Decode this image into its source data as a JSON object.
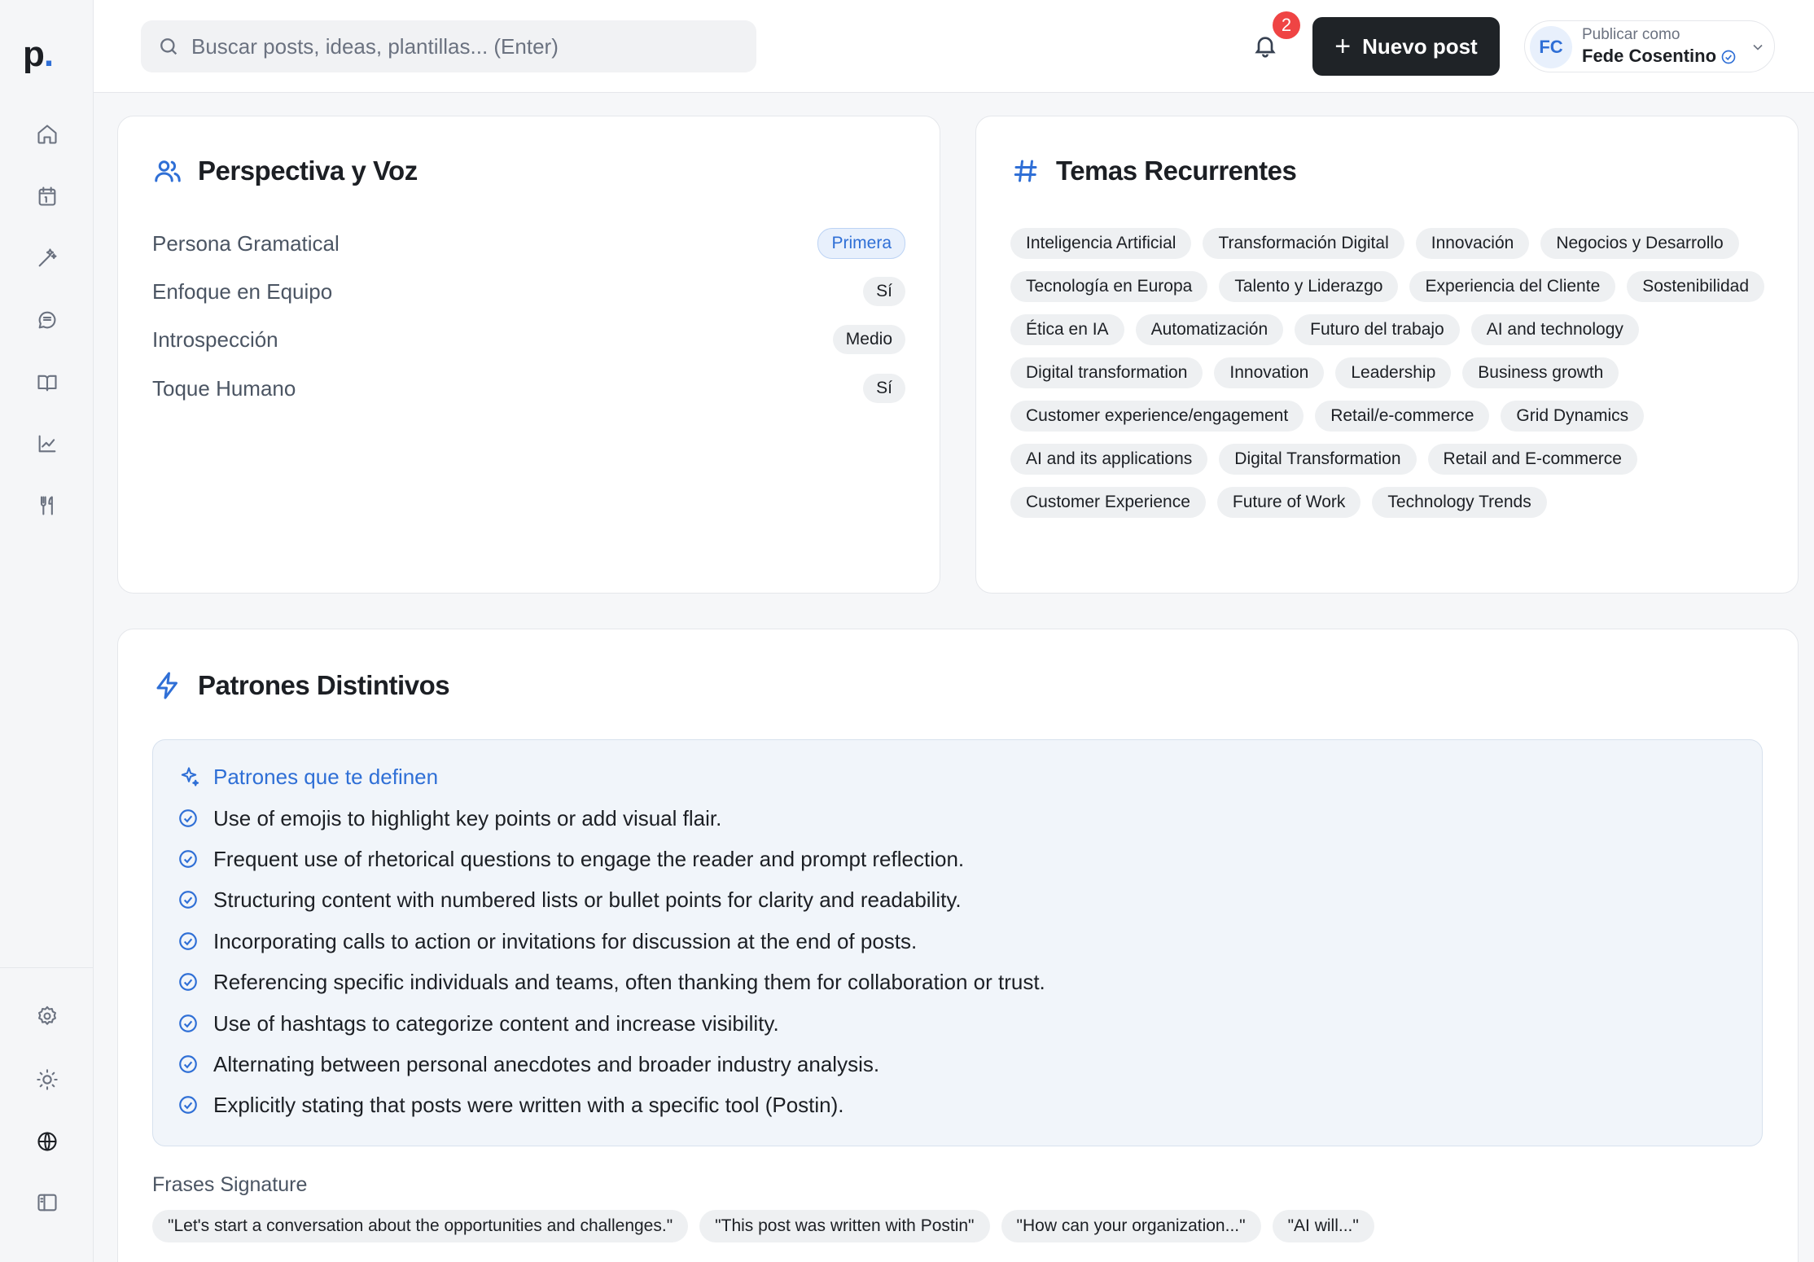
{
  "app": {
    "logo_text": "p",
    "logo_dot": "."
  },
  "search": {
    "placeholder": "Buscar posts, ideas, plantillas... (Enter)"
  },
  "notifications": {
    "count": "2"
  },
  "new_post": {
    "label": "Nuevo post"
  },
  "account": {
    "initials": "FC",
    "label": "Publicar como",
    "name": "Fede Cosentino"
  },
  "perspective": {
    "title": "Perspectiva y Voz",
    "rows": [
      {
        "label": "Persona Gramatical",
        "value": "Primera"
      },
      {
        "label": "Enfoque en Equipo",
        "value": "Sí"
      },
      {
        "label": "Introspección",
        "value": "Medio"
      },
      {
        "label": "Toque Humano",
        "value": "Sí"
      }
    ]
  },
  "topics": {
    "title": "Temas Recurrentes",
    "tags": [
      "Inteligencia Artificial",
      "Transformación Digital",
      "Innovación",
      "Negocios y Desarrollo",
      "Tecnología en Europa",
      "Talento y Liderazgo",
      "Experiencia del Cliente",
      "Sostenibilidad",
      "Ética en IA",
      "Automatización",
      "Futuro del trabajo",
      "AI and technology",
      "Digital transformation",
      "Innovation",
      "Leadership",
      "Business growth",
      "Customer experience/engagement",
      "Retail/e-commerce",
      "Grid Dynamics",
      "AI and its applications",
      "Digital Transformation",
      "Retail and E-commerce",
      "Customer Experience",
      "Future of Work",
      "Technology Trends"
    ]
  },
  "patterns": {
    "title": "Patrones Distintivos",
    "box_title": "Patrones que te definen",
    "items": [
      "Use of emojis to highlight key points or add visual flair.",
      "Frequent use of rhetorical questions to engage the reader and prompt reflection.",
      "Structuring content with numbered lists or bullet points for clarity and readability.",
      "Incorporating calls to action or invitations for discussion at the end of posts.",
      "Referencing specific individuals and teams, often thanking them for collaboration or trust.",
      "Use of hashtags to categorize content and increase visibility.",
      "Alternating between personal anecdotes and broader industry analysis.",
      "Explicitly stating that posts were written with a specific tool (Postin)."
    ],
    "signature_label": "Frases Signature",
    "signatures": [
      "\"Let's start a conversation about the opportunities and challenges.\"",
      "\"This post was written with Postin\"",
      "\"How can your organization...\"",
      "\"AI will...\""
    ]
  }
}
